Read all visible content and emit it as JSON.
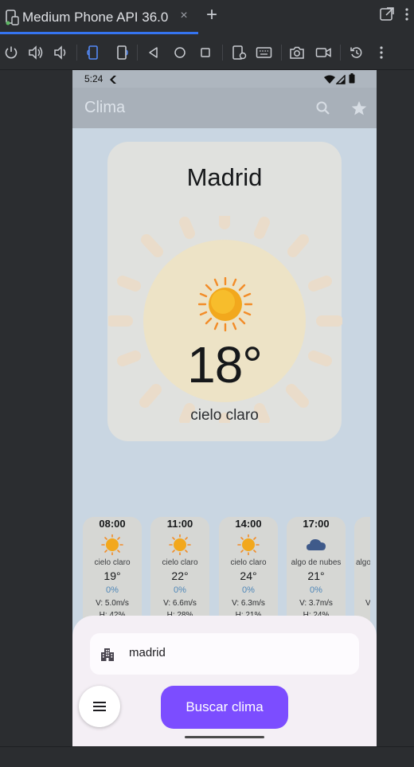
{
  "ide": {
    "tab_title": "Medium Phone API 36.0",
    "tab_close_glyph": "×",
    "tab_add_glyph": "+",
    "accent": "#3574f0",
    "toolbar_icons": [
      "power-icon",
      "volume-up-icon",
      "volume-down-icon",
      "rotate-left-icon",
      "rotate-right-icon",
      "back-icon",
      "home-icon",
      "overview-icon",
      "extended-controls-icon",
      "keyboard-icon",
      "screenshot-icon",
      "screen-record-icon",
      "snapshot-icon",
      "more-icon"
    ]
  },
  "phone": {
    "status_time": "5:24",
    "app_title": "Clima",
    "appbar_icons": [
      "search-icon",
      "star-icon"
    ]
  },
  "weather": {
    "city": "Madrid",
    "temperature": "18°",
    "condition": "cielo claro",
    "icon": "sun-icon"
  },
  "hourly": [
    {
      "time": "08:00",
      "icon": "sun-icon",
      "desc": "cielo claro",
      "temp": "19°",
      "pop": "0%",
      "wind": "V: 5.0m/s",
      "humidity": "H: 42%"
    },
    {
      "time": "11:00",
      "icon": "sun-icon",
      "desc": "cielo claro",
      "temp": "22°",
      "pop": "0%",
      "wind": "V: 6.6m/s",
      "humidity": "H: 28%"
    },
    {
      "time": "14:00",
      "icon": "sun-icon",
      "desc": "cielo claro",
      "temp": "24°",
      "pop": "0%",
      "wind": "V: 6.3m/s",
      "humidity": "H: 21%"
    },
    {
      "time": "17:00",
      "icon": "cloud-icon",
      "desc": "algo de nubes",
      "temp": "21°",
      "pop": "0%",
      "wind": "V: 3.7m/s",
      "humidity": "H: 24%"
    },
    {
      "time": "",
      "icon": "",
      "desc": "algo",
      "temp": "",
      "pop": "",
      "wind": "V",
      "humidity": ""
    }
  ],
  "search": {
    "input_value": "madrid",
    "input_icon": "city-icon",
    "button_label": "Buscar clima",
    "menu_icon": "menu-icon",
    "button_color": "#7c4dff"
  }
}
